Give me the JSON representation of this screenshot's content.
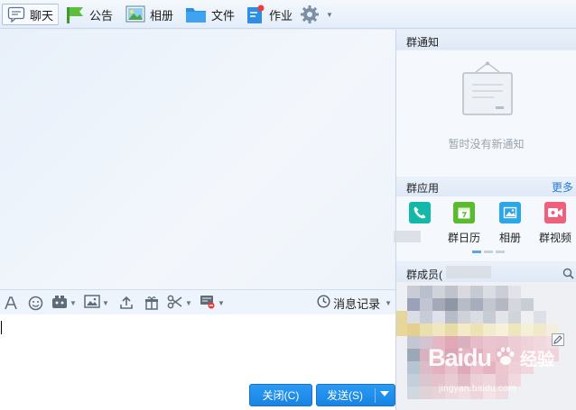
{
  "toolbar": {
    "items": [
      {
        "label": "聊天",
        "icon": "chat-bubble-icon"
      },
      {
        "label": "公告",
        "icon": "flag-icon"
      },
      {
        "label": "相册",
        "icon": "picture-icon"
      },
      {
        "label": "文件",
        "icon": "folder-icon"
      },
      {
        "label": "作业",
        "icon": "homework-icon"
      },
      {
        "label": "",
        "icon": "gear-icon"
      }
    ]
  },
  "input_toolbar": {
    "icons": [
      "font-icon",
      "emoji-icon",
      "magic-icon",
      "image-icon",
      "upload-icon",
      "gift-icon",
      "scissors-icon",
      "screen-icon"
    ],
    "history_label": "消息记录"
  },
  "buttons": {
    "close": "关闭(C)",
    "send": "发送(S)"
  },
  "right_panel": {
    "notice_title": "群通知",
    "notice_empty": "暂时没有新通知",
    "apps_title": "群应用",
    "more": "更多",
    "apps": [
      {
        "label": "",
        "icon": "phone-icon",
        "color": "#13b8a8"
      },
      {
        "label": "群日历",
        "icon": "calendar-icon",
        "color": "#5cba2f"
      },
      {
        "label": "相册",
        "icon": "album-icon",
        "color": "#2aa7e8"
      },
      {
        "label": "群视频",
        "icon": "video-icon",
        "color": "#f0607d"
      }
    ],
    "members_title": "群成员("
  },
  "watermark": {
    "brand": "Baidu",
    "cn": "经验",
    "url": "jingyan.baidu.com"
  },
  "colors": {
    "accent": "#1a86e6",
    "link": "#2a7bd6"
  }
}
